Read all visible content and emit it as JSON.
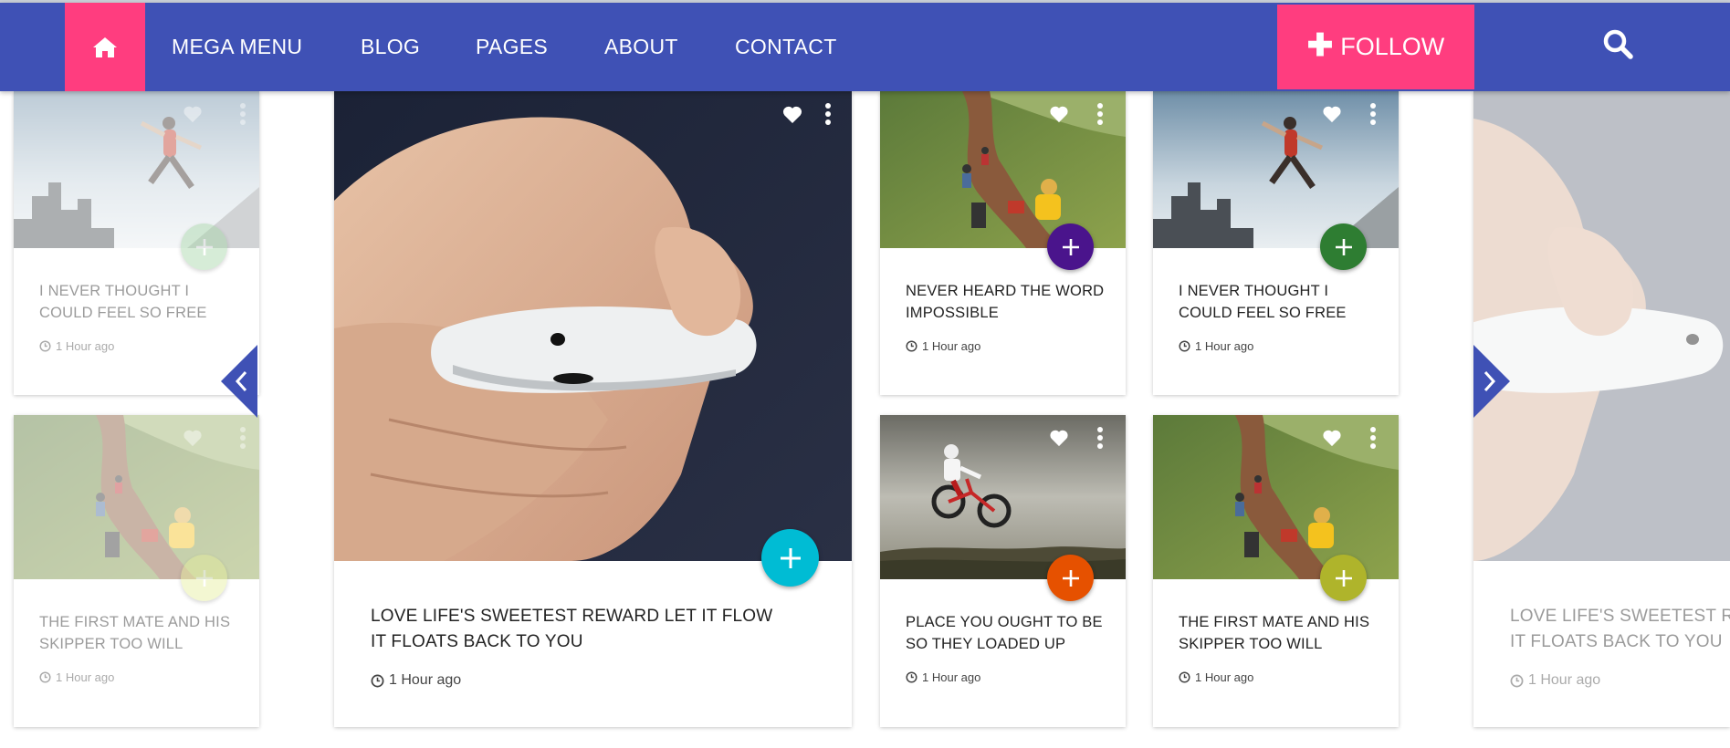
{
  "nav": {
    "items": [
      {
        "label": "MEGA MENU"
      },
      {
        "label": "BLOG"
      },
      {
        "label": "PAGES"
      },
      {
        "label": "ABOUT"
      },
      {
        "label": "CONTACT"
      }
    ],
    "follow_label": "FOLLOW",
    "icons": {
      "home": "home-icon",
      "search": "search-icon",
      "follow": "plus-icon"
    }
  },
  "colors": {
    "navbar": "#3f51b5",
    "accent_pink": "#ff3d7f",
    "arrow_blue": "#3f51b5"
  },
  "cards": [
    {
      "title_line1": "I NEVER THOUGHT I",
      "title_line2": "COULD FEEL SO FREE",
      "time": "1 Hour ago",
      "image": "runner-city",
      "fab_color": "#a5d6a7",
      "faded": true
    },
    {
      "title_line1": "THE FIRST MATE AND HIS",
      "title_line2": "SKIPPER TOO WILL",
      "time": "1 Hour ago",
      "image": "hikers-hill",
      "fab_color": "#e6ee9c",
      "faded": true
    },
    {
      "title_line1": "LOVE LIFE'S SWEETEST REWARD LET IT FLOW",
      "title_line2": "IT FLOATS BACK TO YOU",
      "time": "1 Hour ago",
      "image": "phone-hand",
      "fab_color": "#00bcd4",
      "faded": false
    },
    {
      "title_line1": "NEVER HEARD THE WORD",
      "title_line2": "IMPOSSIBLE",
      "time": "1 Hour ago",
      "image": "hikers-hill",
      "fab_color": "#4a148c",
      "faded": false
    },
    {
      "title_line1": "I NEVER THOUGHT I",
      "title_line2": "COULD FEEL SO FREE",
      "time": "1 Hour ago",
      "image": "runner-city",
      "fab_color": "#2e7d32",
      "faded": false
    },
    {
      "title_line1": "PLACE YOU OUGHT TO BE",
      "title_line2": "SO THEY LOADED UP",
      "time": "1 Hour ago",
      "image": "bike-jump",
      "fab_color": "#e65100",
      "faded": false
    },
    {
      "title_line1": "THE FIRST MATE AND HIS",
      "title_line2": "SKIPPER TOO WILL",
      "time": "1 Hour ago",
      "image": "hikers-hill",
      "fab_color": "#afb42b",
      "faded": false
    },
    {
      "title_line1": "LOVE LIFE'S SWEETEST RE",
      "title_line2": "IT FLOATS BACK TO YOU",
      "time": "1 Hour ago",
      "image": "phone-hand",
      "fab_color": "#00bcd4",
      "faded": true
    }
  ],
  "carousel": {
    "prev_icon": "chevron-left-icon",
    "next_icon": "chevron-right-icon"
  }
}
